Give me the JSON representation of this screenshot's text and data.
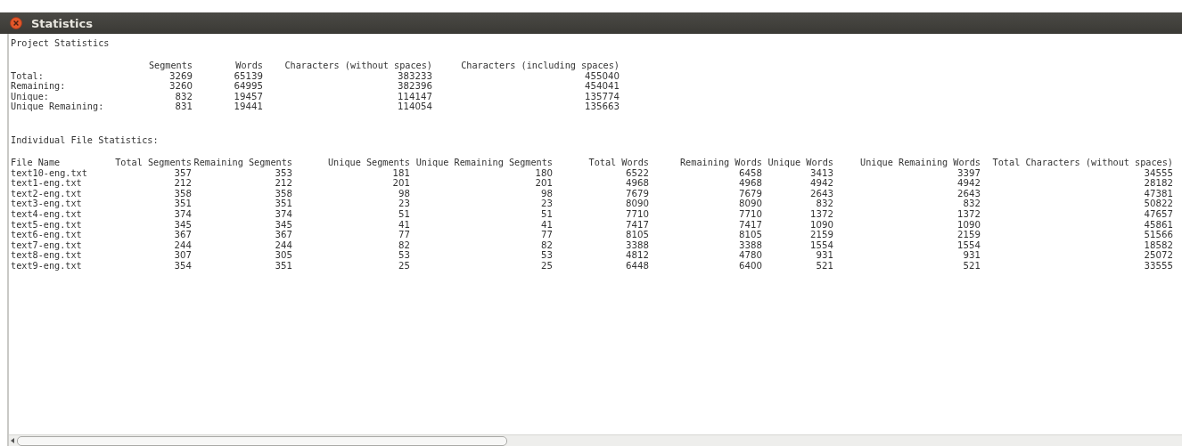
{
  "window": {
    "title": "Statistics"
  },
  "project": {
    "heading": "Project Statistics",
    "columns": [
      "",
      "Segments",
      "Words",
      "Characters (without spaces)",
      "Characters (including spaces)"
    ],
    "rows": [
      [
        "Total:",
        "3269",
        "65139",
        "383233",
        "455040"
      ],
      [
        "Remaining:",
        "3260",
        "64995",
        "382396",
        "454041"
      ],
      [
        "Unique:",
        "832",
        "19457",
        "114147",
        "135774"
      ],
      [
        "Unique Remaining:",
        "831",
        "19441",
        "114054",
        "135663"
      ]
    ]
  },
  "files": {
    "heading": "Individual File Statistics:",
    "columns": [
      "File Name",
      "Total Segments",
      "Remaining Segments",
      "Unique Segments",
      "Unique Remaining Segments",
      "Total Words",
      "Remaining Words",
      "Unique Words",
      "Unique Remaining Words",
      "Total Characters (without spaces)"
    ],
    "rows": [
      [
        "text10-eng.txt",
        "357",
        "353",
        "181",
        "180",
        "6522",
        "6458",
        "3413",
        "3397",
        "34555"
      ],
      [
        "text1-eng.txt",
        "212",
        "212",
        "201",
        "201",
        "4968",
        "4968",
        "4942",
        "4942",
        "28182"
      ],
      [
        "text2-eng.txt",
        "358",
        "358",
        "98",
        "98",
        "7679",
        "7679",
        "2643",
        "2643",
        "47381"
      ],
      [
        "text3-eng.txt",
        "351",
        "351",
        "23",
        "23",
        "8090",
        "8090",
        "832",
        "832",
        "50822"
      ],
      [
        "text4-eng.txt",
        "374",
        "374",
        "51",
        "51",
        "7710",
        "7710",
        "1372",
        "1372",
        "47657"
      ],
      [
        "text5-eng.txt",
        "345",
        "345",
        "41",
        "41",
        "7417",
        "7417",
        "1090",
        "1090",
        "45861"
      ],
      [
        "text6-eng.txt",
        "367",
        "367",
        "77",
        "77",
        "8105",
        "8105",
        "2159",
        "2159",
        "51566"
      ],
      [
        "text7-eng.txt",
        "244",
        "244",
        "82",
        "82",
        "3388",
        "3388",
        "1554",
        "1554",
        "18582"
      ],
      [
        "text8-eng.txt",
        "307",
        "305",
        "53",
        "53",
        "4812",
        "4780",
        "931",
        "931",
        "25072"
      ],
      [
        "text9-eng.txt",
        "354",
        "351",
        "25",
        "25",
        "6448",
        "6400",
        "521",
        "521",
        "33555"
      ]
    ]
  }
}
